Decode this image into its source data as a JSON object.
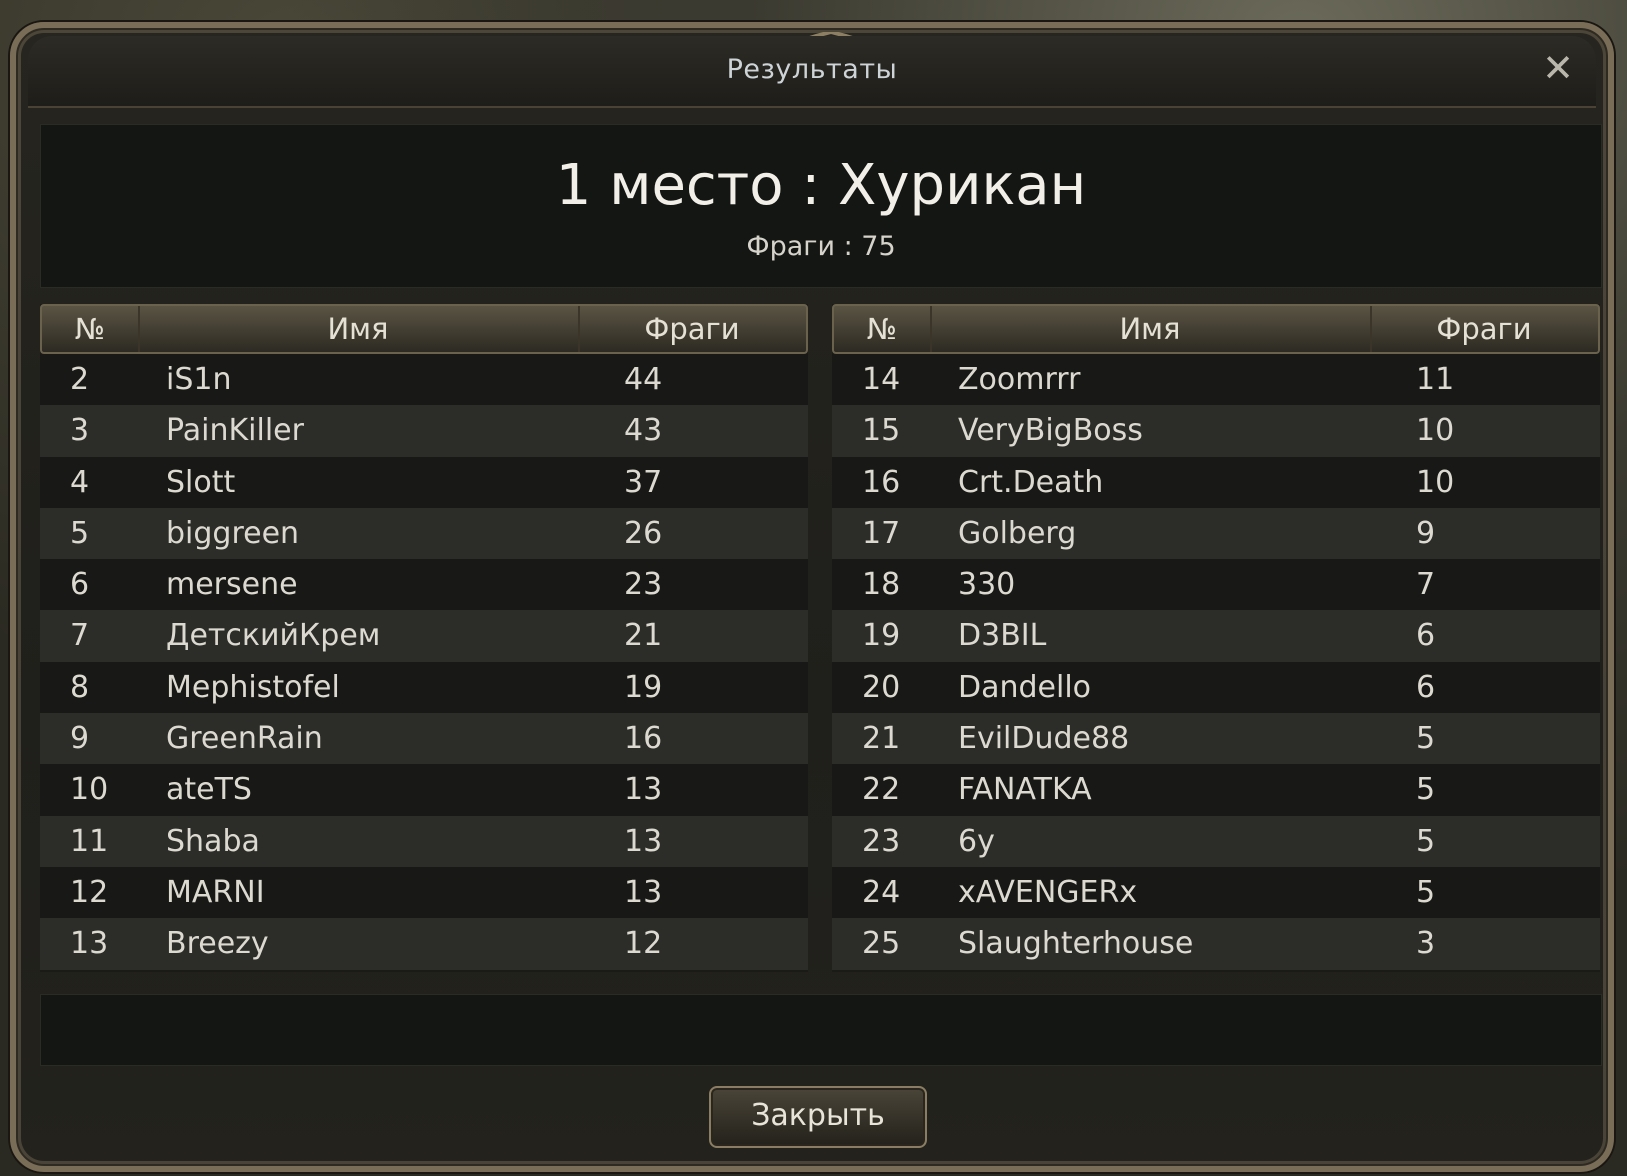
{
  "dialog": {
    "title": "Результаты",
    "close_label": "✕"
  },
  "winner": {
    "title": "1 место : Хурикан",
    "frags": "Фраги : 75"
  },
  "columns": {
    "number": "№",
    "name": "Имя",
    "frags": "Фраги"
  },
  "left_table": [
    {
      "num": "2",
      "name": "iS1n",
      "frags": "44"
    },
    {
      "num": "3",
      "name": "PainKiller",
      "frags": "43"
    },
    {
      "num": "4",
      "name": "Slott",
      "frags": "37"
    },
    {
      "num": "5",
      "name": "biggreen",
      "frags": "26"
    },
    {
      "num": "6",
      "name": "mersene",
      "frags": "23"
    },
    {
      "num": "7",
      "name": "ДетскийКрем",
      "frags": "21"
    },
    {
      "num": "8",
      "name": "Mephistofel",
      "frags": "19"
    },
    {
      "num": "9",
      "name": "GreenRain",
      "frags": "16"
    },
    {
      "num": "10",
      "name": "ateTS",
      "frags": "13"
    },
    {
      "num": "11",
      "name": "Shaba",
      "frags": "13"
    },
    {
      "num": "12",
      "name": "MARNI",
      "frags": "13"
    },
    {
      "num": "13",
      "name": "Breezy",
      "frags": "12"
    }
  ],
  "right_table": [
    {
      "num": "14",
      "name": "Zoomrrr",
      "frags": "11"
    },
    {
      "num": "15",
      "name": "VeryBigBoss",
      "frags": "10"
    },
    {
      "num": "16",
      "name": "Crt.Death",
      "frags": "10"
    },
    {
      "num": "17",
      "name": "Golberg",
      "frags": "9"
    },
    {
      "num": "18",
      "name": "330",
      "frags": "7"
    },
    {
      "num": "19",
      "name": "D3BIL",
      "frags": "6"
    },
    {
      "num": "20",
      "name": "Dandello",
      "frags": "6"
    },
    {
      "num": "21",
      "name": "EvilDude88",
      "frags": "5"
    },
    {
      "num": "22",
      "name": "FANATKA",
      "frags": "5"
    },
    {
      "num": "23",
      "name": "6y",
      "frags": "5"
    },
    {
      "num": "24",
      "name": "xAVENGERx",
      "frags": "5"
    },
    {
      "num": "25",
      "name": "Slaughterhouse",
      "frags": "3"
    }
  ],
  "footer": {
    "close_button": "Закрыть"
  }
}
